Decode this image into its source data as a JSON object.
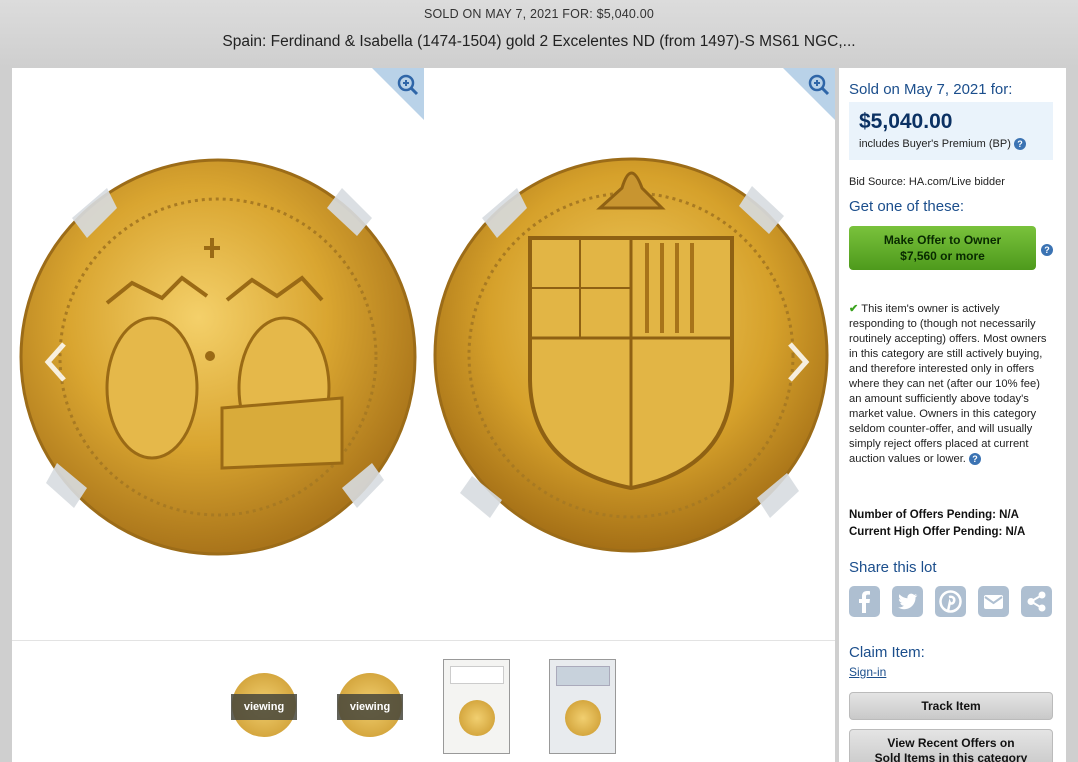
{
  "header": {
    "sold_line": "SOLD ON MAY 7, 2021 FOR: $5,040.00",
    "title": "Spain: Ferdinand & Isabella (1474-1504) gold 2 Excelentes ND (from 1497)-S MS61 NGC,..."
  },
  "gallery": {
    "thumbnails": [
      {
        "label": "viewing",
        "kind": "coin-obverse"
      },
      {
        "label": "viewing",
        "kind": "coin-reverse"
      },
      {
        "kind": "slab-front"
      },
      {
        "kind": "slab-back"
      }
    ]
  },
  "sidebar": {
    "sold_on": "Sold on May 7, 2021 for:",
    "price": "$5,040.00",
    "bp_note": "includes Buyer's Premium (BP)",
    "help_glyph": "?",
    "bid_source": "Bid Source: HA.com/Live bidder",
    "get_one": "Get one of these:",
    "offer_button": {
      "line1": "Make Offer to Owner",
      "line2": "$7,560 or more"
    },
    "owner_note": "This item's owner is actively responding to (though not necessarily routinely accepting) offers. Most owners in this category are still actively buying, and therefore interested only in offers where they can net (after our 10% fee) an amount sufficiently above today's market value. Owners in this category seldom counter-offer, and will usually simply reject offers placed at current auction values or lower.",
    "check_glyph": "✔",
    "offers_pending": "Number of Offers Pending: N/A",
    "high_offer": "Current High Offer Pending: N/A",
    "share_title": "Share this lot",
    "share_icons": [
      "facebook-icon",
      "twitter-icon",
      "pinterest-icon",
      "email-icon",
      "share-icon"
    ],
    "claim_title": "Claim Item:",
    "signin": "Sign-in",
    "track_button": "Track Item",
    "recent_offers_button": {
      "line1": "View Recent Offers on",
      "line2": "Sold Items in this category"
    }
  },
  "colors": {
    "accent_blue": "#1b4e8c",
    "offer_green": "#5eab2a",
    "gold": "#d4a72c"
  }
}
